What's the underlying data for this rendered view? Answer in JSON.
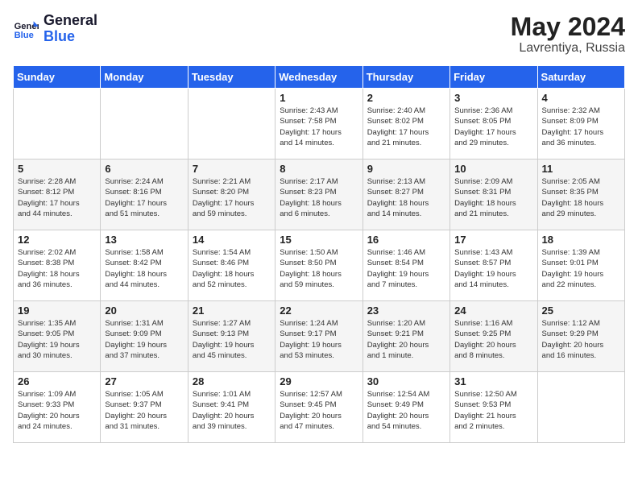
{
  "header": {
    "logo_general": "General",
    "logo_blue": "Blue",
    "month_year": "May 2024",
    "location": "Lavrentiya, Russia"
  },
  "days_of_week": [
    "Sunday",
    "Monday",
    "Tuesday",
    "Wednesday",
    "Thursday",
    "Friday",
    "Saturday"
  ],
  "weeks": [
    [
      {
        "day": "",
        "info": ""
      },
      {
        "day": "",
        "info": ""
      },
      {
        "day": "",
        "info": ""
      },
      {
        "day": "1",
        "info": "Sunrise: 2:43 AM\nSunset: 7:58 PM\nDaylight: 17 hours\nand 14 minutes."
      },
      {
        "day": "2",
        "info": "Sunrise: 2:40 AM\nSunset: 8:02 PM\nDaylight: 17 hours\nand 21 minutes."
      },
      {
        "day": "3",
        "info": "Sunrise: 2:36 AM\nSunset: 8:05 PM\nDaylight: 17 hours\nand 29 minutes."
      },
      {
        "day": "4",
        "info": "Sunrise: 2:32 AM\nSunset: 8:09 PM\nDaylight: 17 hours\nand 36 minutes."
      }
    ],
    [
      {
        "day": "5",
        "info": "Sunrise: 2:28 AM\nSunset: 8:12 PM\nDaylight: 17 hours\nand 44 minutes."
      },
      {
        "day": "6",
        "info": "Sunrise: 2:24 AM\nSunset: 8:16 PM\nDaylight: 17 hours\nand 51 minutes."
      },
      {
        "day": "7",
        "info": "Sunrise: 2:21 AM\nSunset: 8:20 PM\nDaylight: 17 hours\nand 59 minutes."
      },
      {
        "day": "8",
        "info": "Sunrise: 2:17 AM\nSunset: 8:23 PM\nDaylight: 18 hours\nand 6 minutes."
      },
      {
        "day": "9",
        "info": "Sunrise: 2:13 AM\nSunset: 8:27 PM\nDaylight: 18 hours\nand 14 minutes."
      },
      {
        "day": "10",
        "info": "Sunrise: 2:09 AM\nSunset: 8:31 PM\nDaylight: 18 hours\nand 21 minutes."
      },
      {
        "day": "11",
        "info": "Sunrise: 2:05 AM\nSunset: 8:35 PM\nDaylight: 18 hours\nand 29 minutes."
      }
    ],
    [
      {
        "day": "12",
        "info": "Sunrise: 2:02 AM\nSunset: 8:38 PM\nDaylight: 18 hours\nand 36 minutes."
      },
      {
        "day": "13",
        "info": "Sunrise: 1:58 AM\nSunset: 8:42 PM\nDaylight: 18 hours\nand 44 minutes."
      },
      {
        "day": "14",
        "info": "Sunrise: 1:54 AM\nSunset: 8:46 PM\nDaylight: 18 hours\nand 52 minutes."
      },
      {
        "day": "15",
        "info": "Sunrise: 1:50 AM\nSunset: 8:50 PM\nDaylight: 18 hours\nand 59 minutes."
      },
      {
        "day": "16",
        "info": "Sunrise: 1:46 AM\nSunset: 8:54 PM\nDaylight: 19 hours\nand 7 minutes."
      },
      {
        "day": "17",
        "info": "Sunrise: 1:43 AM\nSunset: 8:57 PM\nDaylight: 19 hours\nand 14 minutes."
      },
      {
        "day": "18",
        "info": "Sunrise: 1:39 AM\nSunset: 9:01 PM\nDaylight: 19 hours\nand 22 minutes."
      }
    ],
    [
      {
        "day": "19",
        "info": "Sunrise: 1:35 AM\nSunset: 9:05 PM\nDaylight: 19 hours\nand 30 minutes."
      },
      {
        "day": "20",
        "info": "Sunrise: 1:31 AM\nSunset: 9:09 PM\nDaylight: 19 hours\nand 37 minutes."
      },
      {
        "day": "21",
        "info": "Sunrise: 1:27 AM\nSunset: 9:13 PM\nDaylight: 19 hours\nand 45 minutes."
      },
      {
        "day": "22",
        "info": "Sunrise: 1:24 AM\nSunset: 9:17 PM\nDaylight: 19 hours\nand 53 minutes."
      },
      {
        "day": "23",
        "info": "Sunrise: 1:20 AM\nSunset: 9:21 PM\nDaylight: 20 hours\nand 1 minute."
      },
      {
        "day": "24",
        "info": "Sunrise: 1:16 AM\nSunset: 9:25 PM\nDaylight: 20 hours\nand 8 minutes."
      },
      {
        "day": "25",
        "info": "Sunrise: 1:12 AM\nSunset: 9:29 PM\nDaylight: 20 hours\nand 16 minutes."
      }
    ],
    [
      {
        "day": "26",
        "info": "Sunrise: 1:09 AM\nSunset: 9:33 PM\nDaylight: 20 hours\nand 24 minutes."
      },
      {
        "day": "27",
        "info": "Sunrise: 1:05 AM\nSunset: 9:37 PM\nDaylight: 20 hours\nand 31 minutes."
      },
      {
        "day": "28",
        "info": "Sunrise: 1:01 AM\nSunset: 9:41 PM\nDaylight: 20 hours\nand 39 minutes."
      },
      {
        "day": "29",
        "info": "Sunrise: 12:57 AM\nSunset: 9:45 PM\nDaylight: 20 hours\nand 47 minutes."
      },
      {
        "day": "30",
        "info": "Sunrise: 12:54 AM\nSunset: 9:49 PM\nDaylight: 20 hours\nand 54 minutes."
      },
      {
        "day": "31",
        "info": "Sunrise: 12:50 AM\nSunset: 9:53 PM\nDaylight: 21 hours\nand 2 minutes."
      },
      {
        "day": "",
        "info": ""
      }
    ]
  ]
}
